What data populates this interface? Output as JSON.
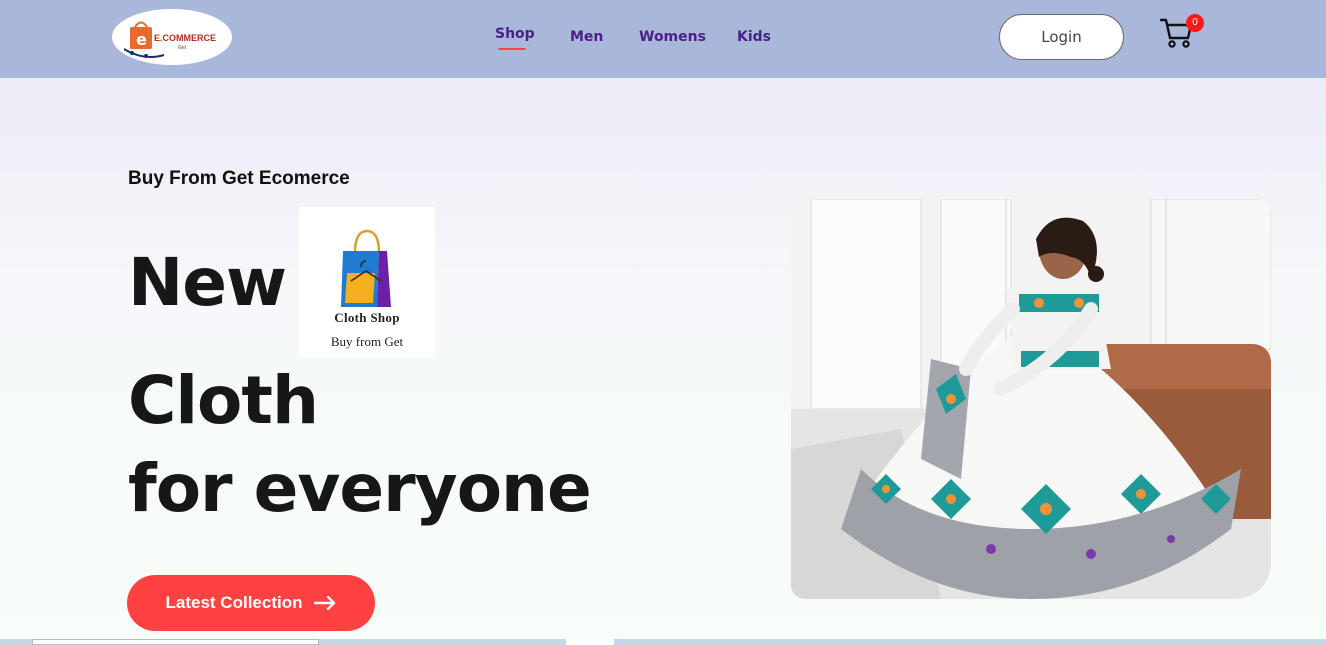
{
  "navbar": {
    "logo_text": "E.COMMERCE",
    "logo_subtext": "Get",
    "links": [
      {
        "label": "Shop"
      },
      {
        "label": "Men"
      },
      {
        "label": "Womens"
      },
      {
        "label": "Kids"
      }
    ],
    "active_link": "Shop",
    "login_label": "Login",
    "cart_count": "0"
  },
  "hero": {
    "eyebrow": "Buy From Get Ecomerce",
    "line1": "New",
    "line2": "Cloth",
    "line3": "for everyone",
    "card_title": "Cloth Shop",
    "card_subtitle": "Buy from Get",
    "cta_label": "Latest Collection",
    "image_icon": "woman-in-dress-photo"
  },
  "colors": {
    "navbar_bg": "#a9b8da",
    "accent": "#ff4141",
    "nav_text": "#4a1f86"
  }
}
